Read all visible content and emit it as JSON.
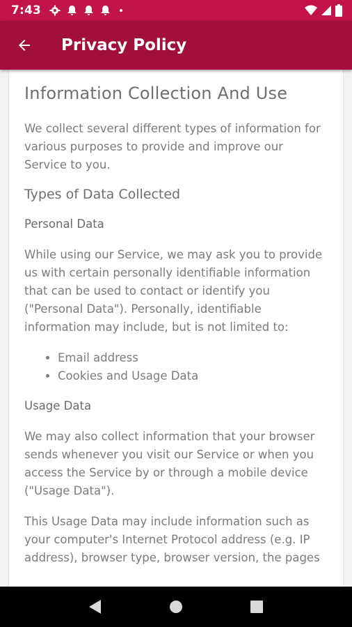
{
  "status_bar": {
    "time": "7:43",
    "icons_left": [
      "gear-icon",
      "notification-bell-icon",
      "notification-bell-icon",
      "notification-bell-icon",
      "dot-icon"
    ],
    "icons_right": [
      "wifi-icon",
      "signal-icon",
      "battery-icon"
    ]
  },
  "app_bar": {
    "title": "Privacy Policy",
    "back_icon": "arrow-left-icon",
    "background": "#a30f3d"
  },
  "colors": {
    "status_bar": "#c2144a",
    "app_bar": "#a30f3d",
    "text": "#7b7b7b"
  },
  "content": {
    "heading": "Information Collection And Use",
    "intro": "We collect several different types of information for various purposes to provide and improve our Service to you.",
    "types_heading": "Types of Data Collected",
    "personal_heading": "Personal Data",
    "personal_text": "While using our Service, we may ask you to provide us with certain personally identifiable information that can be used to contact or identify you (\"Personal Data\"). Personally, identifiable information may include, but is not limited to:",
    "personal_items": [
      "Email address",
      "Cookies and Usage Data"
    ],
    "usage_heading": "Usage Data",
    "usage_text": "We may also collect information that your browser sends whenever you visit our Service or when you access the Service by or through a mobile device (\"Usage Data\").",
    "usage_text_2": "This Usage Data may include information such as your computer's Internet Protocol address (e.g. IP address), browser type, browser version, the pages"
  },
  "nav_bar": {
    "buttons": [
      "back-triangle-icon",
      "home-circle-icon",
      "recents-square-icon"
    ]
  }
}
